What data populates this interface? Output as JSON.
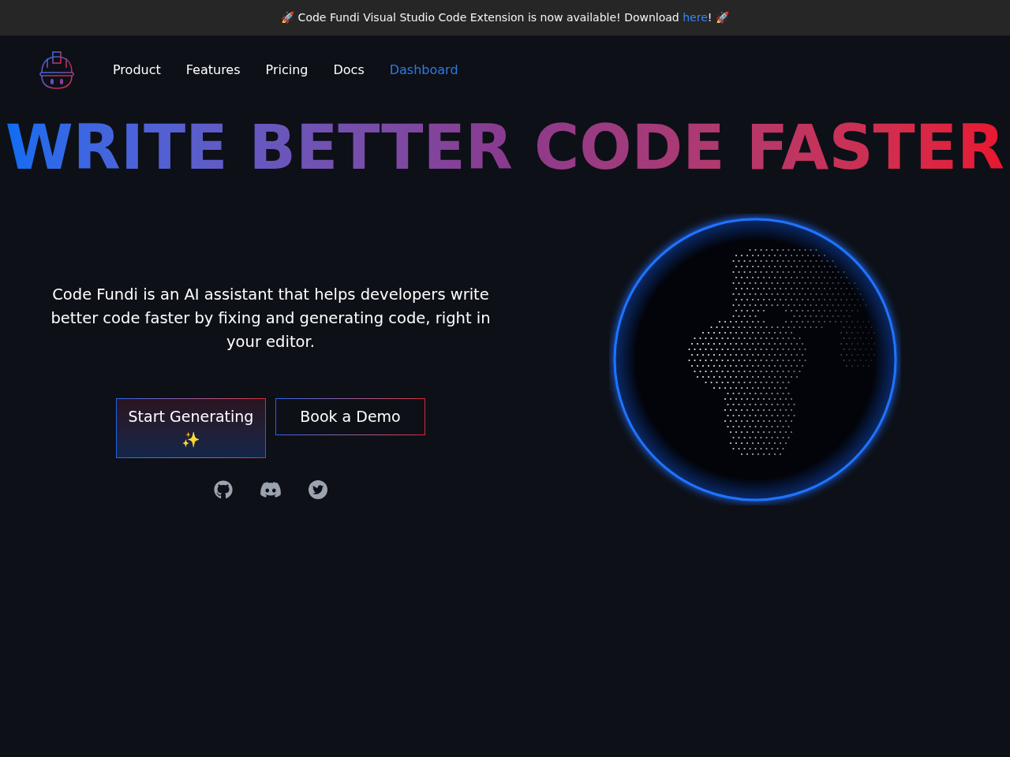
{
  "banner": {
    "text": "🚀 Code Fundi Visual Studio Code Extension is now available! Download ",
    "link": "here",
    "text_after": "! 🚀"
  },
  "nav": [
    {
      "label": "Product",
      "selected": false
    },
    {
      "label": "Features",
      "selected": false
    },
    {
      "label": "Pricing",
      "selected": false
    },
    {
      "label": "Docs",
      "selected": false
    },
    {
      "label": "Dashboard",
      "selected": true
    }
  ],
  "headline": "WRITE BETTER CODE FASTER",
  "description": "Code Fundi is an AI assistant that helps developers write better code faster by fixing and generating code, right in your editor.",
  "buttons": [
    {
      "label": "Start Generating ✨",
      "kind": "primary"
    },
    {
      "label": "Book a Demo",
      "kind": "secondary"
    }
  ],
  "socials": [
    {
      "kind": "github"
    },
    {
      "kind": "discord"
    },
    {
      "kind": "twitter"
    }
  ]
}
